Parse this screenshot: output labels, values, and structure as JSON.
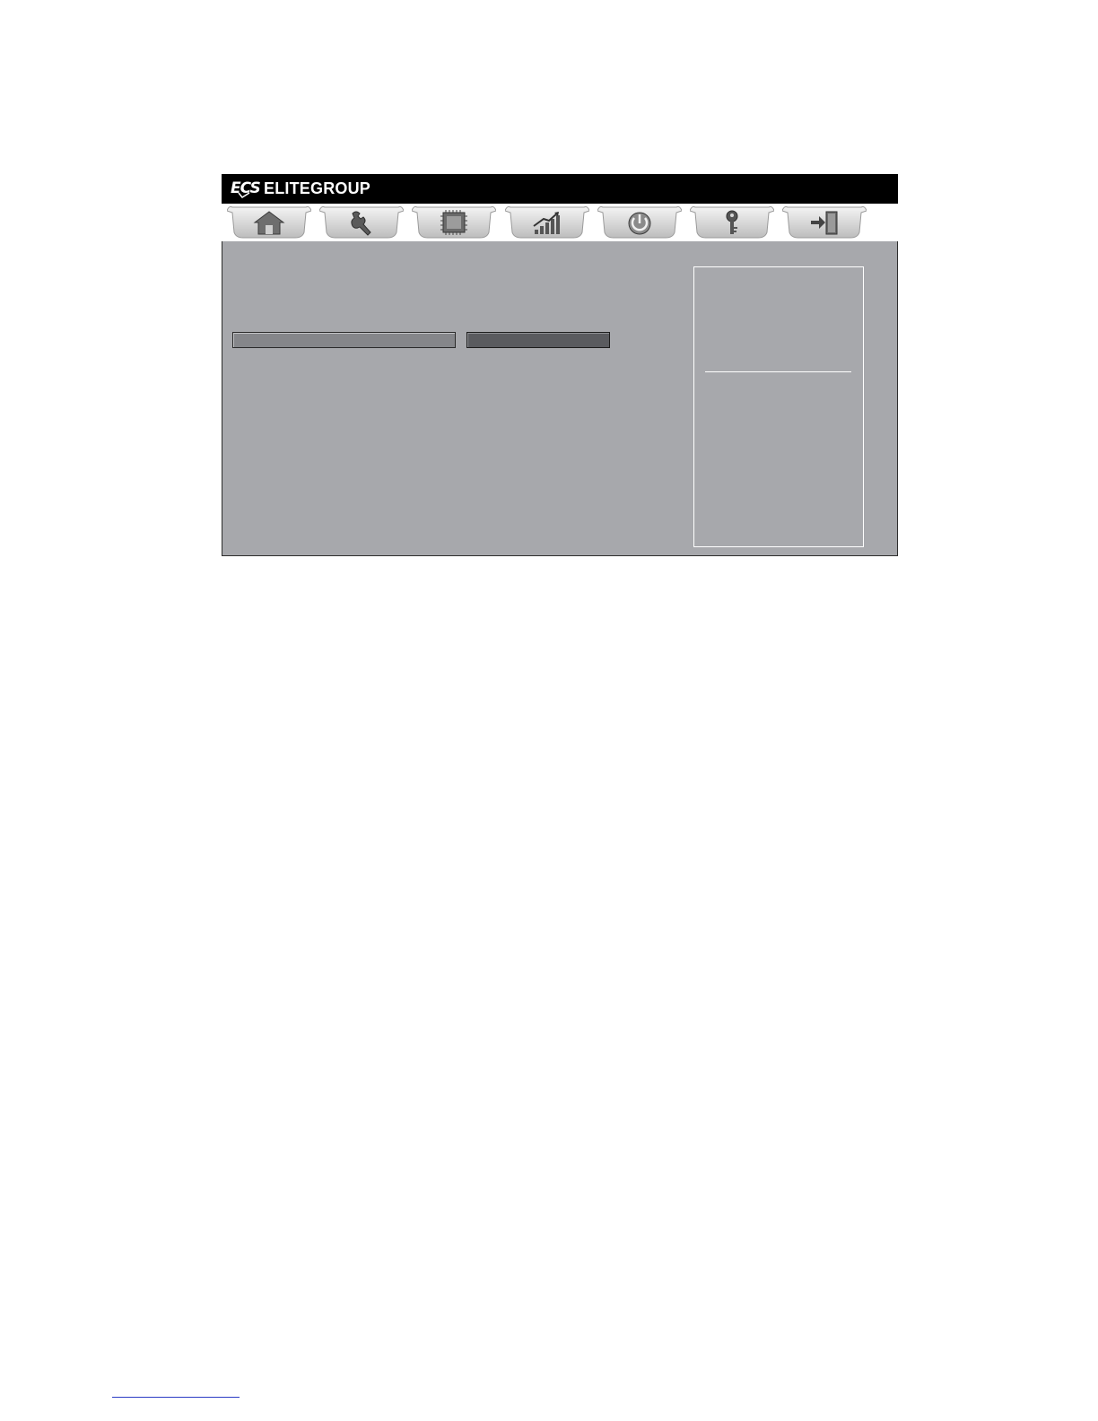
{
  "header": {
    "logo_text": "ECS",
    "brand": "ELITEGROUP"
  },
  "tabs": [
    {
      "name": "main",
      "icon": "home-icon"
    },
    {
      "name": "advanced",
      "icon": "wrench-icon"
    },
    {
      "name": "chipset",
      "icon": "chip-icon"
    },
    {
      "name": "mi",
      "icon": "bar-chart-icon"
    },
    {
      "name": "boot",
      "icon": "power-icon"
    },
    {
      "name": "security",
      "icon": "key-icon"
    },
    {
      "name": "exit",
      "icon": "exit-door-icon"
    }
  ],
  "colors": {
    "title_bar": "#000000",
    "content_bg": "#a7a8ac",
    "field_label_bg": "#85868a",
    "field_value_bg": "#5a5b5f",
    "help_border": "#ffffff",
    "link_underline": "#2b3cc4"
  }
}
